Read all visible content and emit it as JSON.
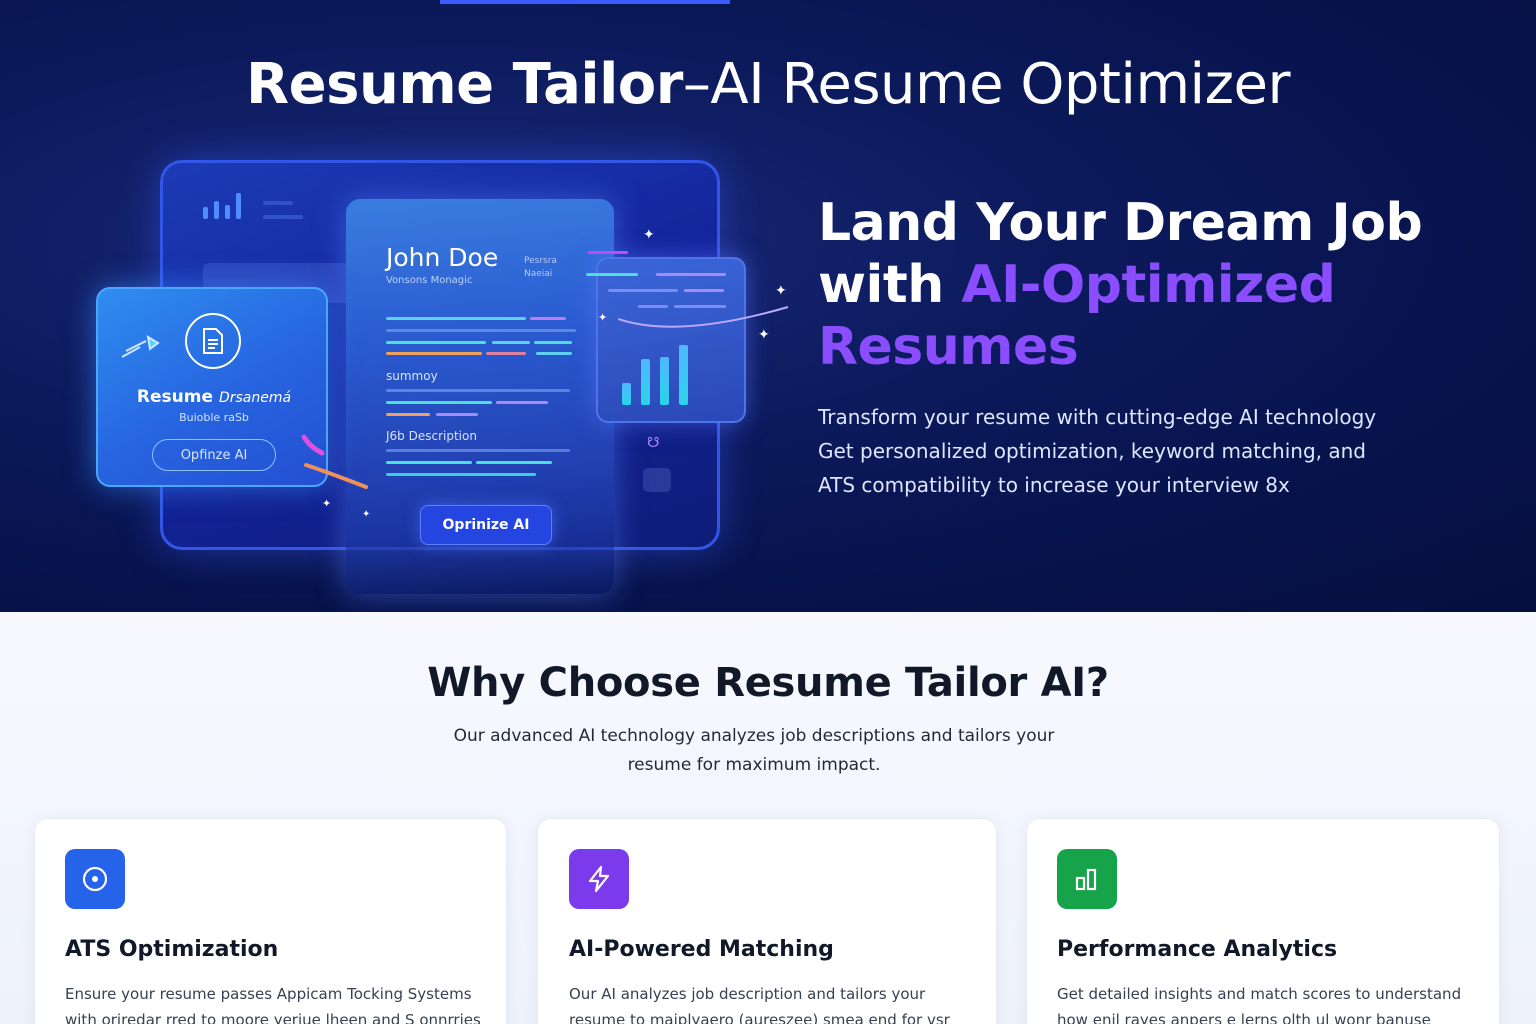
{
  "hero": {
    "title_bold": "Resume  Tailor",
    "title_light": "–AI Resume Optimizer",
    "headline_line1": "Land Your Dream Job",
    "headline_with": "with ",
    "headline_accent": "AI-Optimized",
    "headline_accent2": "Resumes",
    "description": "Transform your resume with cutting-edge AI technology Get personalized optimization, keyword matching, and ATS compatibility to increase your interview 8x",
    "accent_color": "#8a4dff"
  },
  "illustration": {
    "resume_name": "John Doe",
    "resume_role": "Vonsons Monagic",
    "resume_side": "Pesrsra\nNaeiai",
    "summary_label": "summoy",
    "job_label": "J6b Description",
    "resume_button": "Oprinize AI",
    "card_title": "Resume",
    "card_title_script": "Drsanemá",
    "card_sub": "Buioble  raSb",
    "card_button": "Opfinze AI",
    "card_icon": "document-icon"
  },
  "features": {
    "title": "Why Choose Resume Tailor AI?",
    "subtitle": "Our advanced AI technology analyzes job descriptions and tailors your resume for maximum impact.",
    "cards": [
      {
        "icon": "target-icon",
        "color": "#2563eb",
        "title": "ATS Optimization",
        "description": "Ensure your resume passes Appicam Tocking Systems with oriredar rred to moore yeriue lheen and S onnrries"
      },
      {
        "icon": "lightning-icon",
        "color": "#7c3aed",
        "title": "AI-Powered Matching",
        "description": "Our AI analyzes job description and tailors your resume to maiplyaero (aureszee) smea end for vsr va"
      },
      {
        "icon": "bar-chart-icon",
        "color": "#16a34a",
        "title": "Performance Analytics",
        "description": "Get detailed insights and match scores to understand how enil rayes anpers e lerns olth ul wonr banuse"
      }
    ]
  }
}
